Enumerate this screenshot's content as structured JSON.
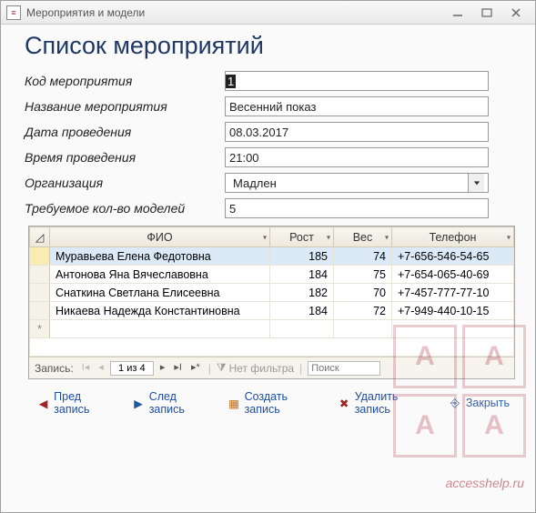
{
  "window": {
    "title": "Мероприятия и модели"
  },
  "page_title": "Список мероприятий",
  "form": {
    "labels": {
      "id": "Код мероприятия",
      "name": "Название мероприятия",
      "date": "Дата проведения",
      "time": "Время проведения",
      "org": "Организация",
      "count": "Требуемое кол-во моделей"
    },
    "values": {
      "id": "1",
      "name": "Весенний показ",
      "date": "08.03.2017",
      "time": "21:00",
      "org": "Мадлен",
      "count": "5"
    }
  },
  "grid": {
    "headers": {
      "fio": "ФИО",
      "height": "Рост",
      "weight": "Вес",
      "phone": "Телефон"
    },
    "rows": [
      {
        "fio": "Муравьева Елена Федотовна",
        "height": "185",
        "weight": "74",
        "phone": "+7-656-546-54-65"
      },
      {
        "fio": "Антонова Яна Вячеславовна",
        "height": "184",
        "weight": "75",
        "phone": "+7-654-065-40-69"
      },
      {
        "fio": "Снаткина Светлана  Елисеевна",
        "height": "182",
        "weight": "70",
        "phone": "+7-457-777-77-10"
      },
      {
        "fio": "Никаева Надежда Константиновна",
        "height": "184",
        "weight": "72",
        "phone": "+7-949-440-10-15"
      }
    ],
    "nav": {
      "label": "Запись:",
      "position": "1 из 4",
      "filter": "Нет фильтра",
      "search_placeholder": "Поиск"
    }
  },
  "actions": {
    "prev": "Пред запись",
    "next": "След запись",
    "create": "Создать запись",
    "delete": "Удалить запись",
    "close": "Закрыть"
  },
  "watermark_text": "accesshelp.ru"
}
